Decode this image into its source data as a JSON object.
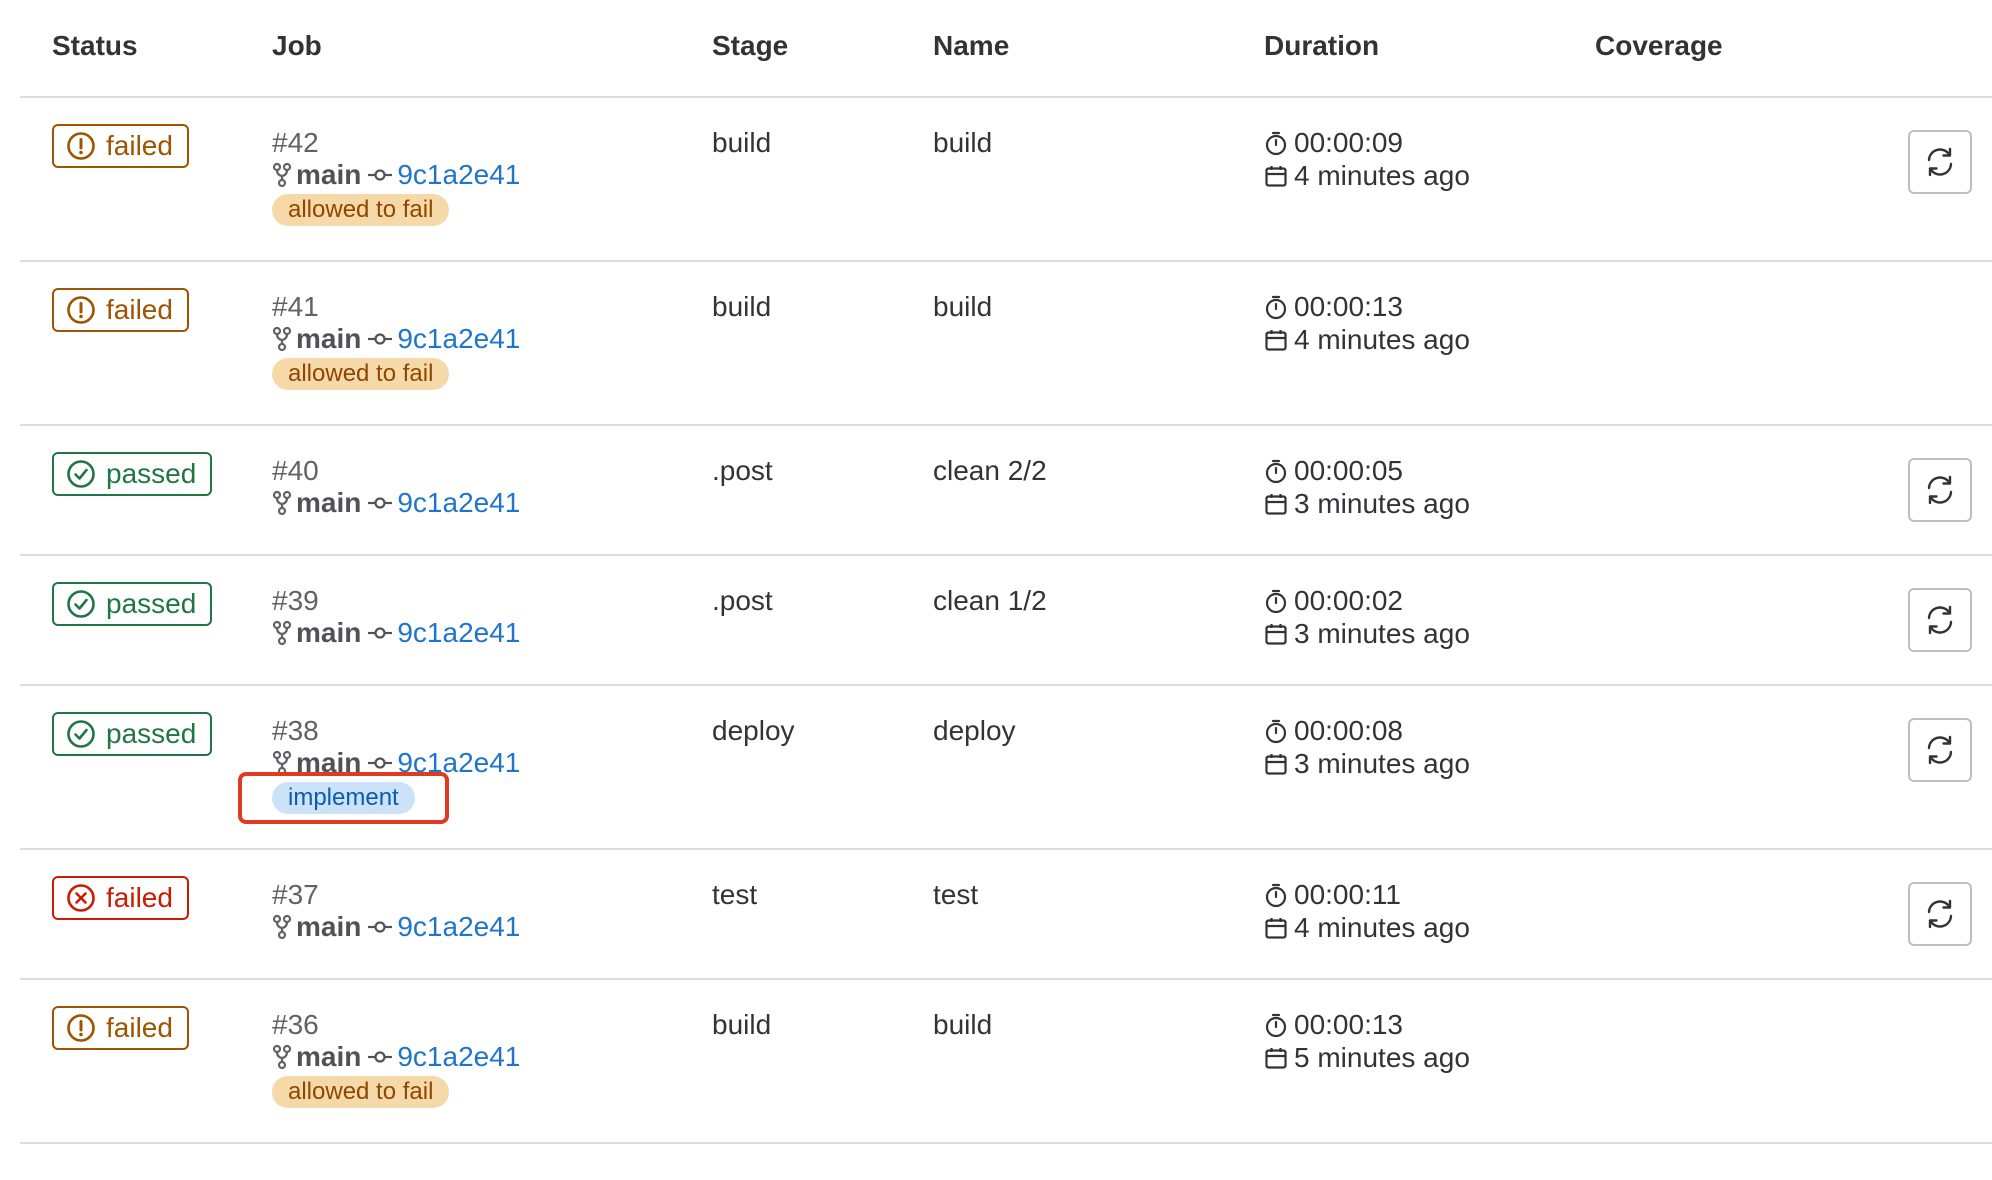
{
  "headers": {
    "status": "Status",
    "job": "Job",
    "stage": "Stage",
    "name": "Name",
    "duration": "Duration",
    "coverage": "Coverage"
  },
  "colors": {
    "warning": "#9e5400",
    "success": "#217645",
    "danger": "#c91c00",
    "link": "#1f75cb",
    "annotation": "#e03a1f"
  },
  "jobs": [
    {
      "status": "failed",
      "status_kind": "warning",
      "status_icon": "exclamation-circle-icon",
      "id": "#42",
      "branch": "main",
      "commit": "9c1a2e41",
      "tag": "allowed to fail",
      "tag_kind": "warning",
      "stage": "build",
      "name": "build",
      "duration": "00:00:09",
      "finished": "4 minutes ago",
      "retry": true
    },
    {
      "status": "failed",
      "status_kind": "warning",
      "status_icon": "exclamation-circle-icon",
      "id": "#41",
      "branch": "main",
      "commit": "9c1a2e41",
      "tag": "allowed to fail",
      "tag_kind": "warning",
      "stage": "build",
      "name": "build",
      "duration": "00:00:13",
      "finished": "4 minutes ago",
      "retry": false
    },
    {
      "status": "passed",
      "status_kind": "success",
      "status_icon": "check-circle-icon",
      "id": "#40",
      "branch": "main",
      "commit": "9c1a2e41",
      "tag": "",
      "tag_kind": "",
      "stage": ".post",
      "name": "clean 2/2",
      "duration": "00:00:05",
      "finished": "3 minutes ago",
      "retry": true
    },
    {
      "status": "passed",
      "status_kind": "success",
      "status_icon": "check-circle-icon",
      "id": "#39",
      "branch": "main",
      "commit": "9c1a2e41",
      "tag": "",
      "tag_kind": "",
      "stage": ".post",
      "name": "clean 1/2",
      "duration": "00:00:02",
      "finished": "3 minutes ago",
      "retry": true
    },
    {
      "status": "passed",
      "status_kind": "success",
      "status_icon": "check-circle-icon",
      "id": "#38",
      "branch": "main",
      "commit": "9c1a2e41",
      "tag": "implement",
      "tag_kind": "info",
      "stage": "deploy",
      "name": "deploy",
      "duration": "00:00:08",
      "finished": "3 minutes ago",
      "retry": true
    },
    {
      "status": "failed",
      "status_kind": "danger",
      "status_icon": "x-circle-icon",
      "id": "#37",
      "branch": "main",
      "commit": "9c1a2e41",
      "tag": "",
      "tag_kind": "",
      "stage": "test",
      "name": "test",
      "duration": "00:00:11",
      "finished": "4 minutes ago",
      "retry": true
    },
    {
      "status": "failed",
      "status_kind": "warning",
      "status_icon": "exclamation-circle-icon",
      "id": "#36",
      "branch": "main",
      "commit": "9c1a2e41",
      "tag": "allowed to fail",
      "tag_kind": "warning",
      "stage": "build",
      "name": "build",
      "duration": "00:00:13",
      "finished": "5 minutes ago",
      "retry": false
    }
  ]
}
